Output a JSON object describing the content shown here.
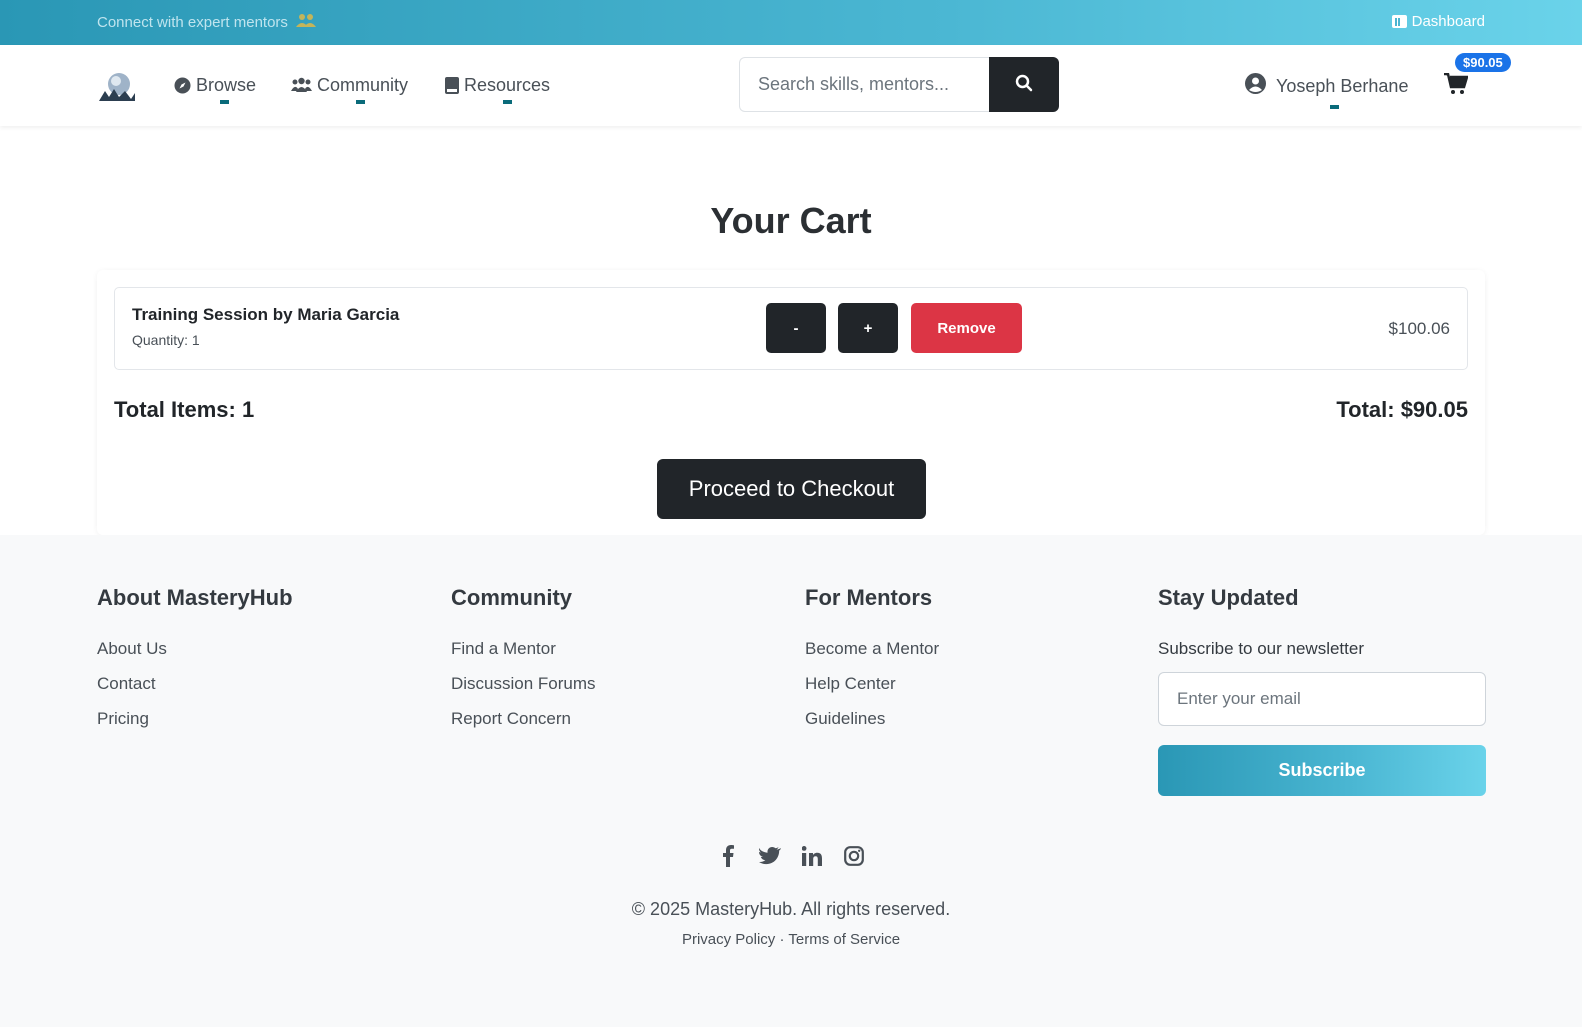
{
  "topbar": {
    "tagline": "Connect with expert mentors",
    "dashboard_label": "Dashboard"
  },
  "nav": {
    "links": [
      {
        "label": "Browse",
        "icon": "compass-icon"
      },
      {
        "label": "Community",
        "icon": "users-icon"
      },
      {
        "label": "Resources",
        "icon": "book-icon"
      }
    ],
    "search_placeholder": "Search skills, mentors...",
    "user_name": "Yoseph Berhane",
    "cart_badge": "$90.05"
  },
  "cart": {
    "title": "Your Cart",
    "items": [
      {
        "name": "Training Session by Maria Garcia",
        "quantity_label": "Quantity: 1",
        "price": "$100.06"
      }
    ],
    "decrement_label": "-",
    "increment_label": "+",
    "remove_label": "Remove",
    "total_items_label": "Total Items: 1",
    "total_label": "Total: $90.05",
    "checkout_label": "Proceed to Checkout"
  },
  "footer": {
    "columns": [
      {
        "heading": "About MasteryHub",
        "links": [
          "About Us",
          "Contact",
          "Pricing"
        ]
      },
      {
        "heading": "Community",
        "links": [
          "Find a Mentor",
          "Discussion Forums",
          "Report Concern"
        ]
      },
      {
        "heading": "For Mentors",
        "links": [
          "Become a Mentor",
          "Help Center",
          "Guidelines"
        ]
      }
    ],
    "newsletter": {
      "heading": "Stay Updated",
      "label": "Subscribe to our newsletter",
      "placeholder": "Enter your email",
      "button_label": "Subscribe"
    },
    "social": [
      "facebook-icon",
      "twitter-icon",
      "linkedin-icon",
      "instagram-icon"
    ],
    "copyright": "© 2025 MasteryHub. All rights reserved.",
    "privacy": "Privacy Policy",
    "separator": " · ",
    "terms": "Terms of Service"
  },
  "colors": {
    "brand_gradient_start": "#2a97b5",
    "brand_gradient_end": "#6ad3ea",
    "dark": "#212529",
    "danger": "#dc3545",
    "badge": "#1a73e8"
  }
}
